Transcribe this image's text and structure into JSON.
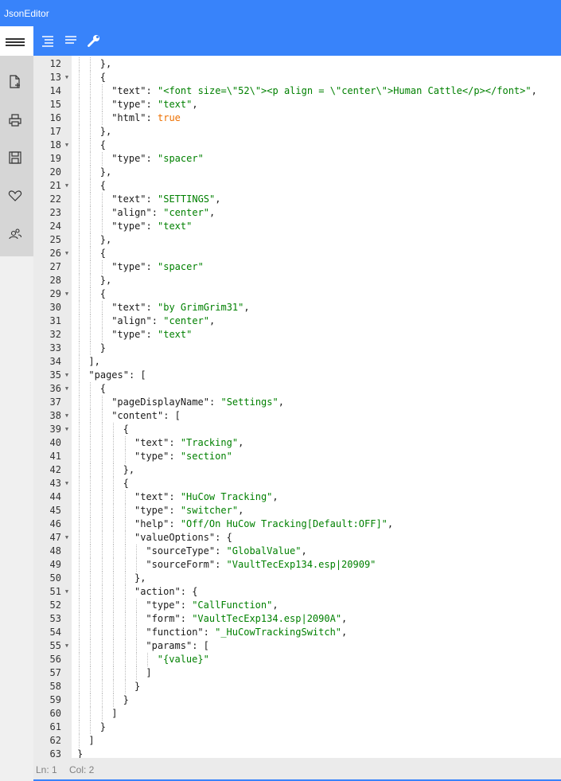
{
  "app": {
    "title": "JsonEditor"
  },
  "sidebar": {
    "icons": [
      "menu-icon",
      "new-file-icon",
      "print-icon",
      "save-icon",
      "heart-icon",
      "users-icon"
    ]
  },
  "toolbar": {
    "icons": [
      "format-json-icon",
      "compact-json-icon",
      "settings-wrench-icon"
    ],
    "accent": "#3883fa"
  },
  "editor": {
    "lines": [
      {
        "n": "12",
        "fold": false,
        "indent": 2,
        "tokens": [
          {
            "t": "},",
            "c": "p"
          }
        ]
      },
      {
        "n": "13",
        "fold": true,
        "indent": 2,
        "tokens": [
          {
            "t": "{",
            "c": "p"
          }
        ]
      },
      {
        "n": "14",
        "fold": false,
        "indent": 3,
        "tokens": [
          {
            "t": "\"text\"",
            "c": "k"
          },
          {
            "t": ": ",
            "c": "p"
          },
          {
            "t": "\"<font size=\\\"52\\\"><p align = \\\"center\\\">Human Cattle</p></font>\"",
            "c": "s"
          },
          {
            "t": ",",
            "c": "p"
          }
        ]
      },
      {
        "n": "15",
        "fold": false,
        "indent": 3,
        "tokens": [
          {
            "t": "\"type\"",
            "c": "k"
          },
          {
            "t": ": ",
            "c": "p"
          },
          {
            "t": "\"text\"",
            "c": "s"
          },
          {
            "t": ",",
            "c": "p"
          }
        ]
      },
      {
        "n": "16",
        "fold": false,
        "indent": 3,
        "tokens": [
          {
            "t": "\"html\"",
            "c": "k"
          },
          {
            "t": ": ",
            "c": "p"
          },
          {
            "t": "true",
            "c": "b"
          }
        ]
      },
      {
        "n": "17",
        "fold": false,
        "indent": 2,
        "tokens": [
          {
            "t": "},",
            "c": "p"
          }
        ]
      },
      {
        "n": "18",
        "fold": true,
        "indent": 2,
        "tokens": [
          {
            "t": "{",
            "c": "p"
          }
        ]
      },
      {
        "n": "19",
        "fold": false,
        "indent": 3,
        "tokens": [
          {
            "t": "\"type\"",
            "c": "k"
          },
          {
            "t": ": ",
            "c": "p"
          },
          {
            "t": "\"spacer\"",
            "c": "s"
          }
        ]
      },
      {
        "n": "20",
        "fold": false,
        "indent": 2,
        "tokens": [
          {
            "t": "},",
            "c": "p"
          }
        ]
      },
      {
        "n": "21",
        "fold": true,
        "indent": 2,
        "tokens": [
          {
            "t": "{",
            "c": "p"
          }
        ]
      },
      {
        "n": "22",
        "fold": false,
        "indent": 3,
        "tokens": [
          {
            "t": "\"text\"",
            "c": "k"
          },
          {
            "t": ": ",
            "c": "p"
          },
          {
            "t": "\"SETTINGS\"",
            "c": "s"
          },
          {
            "t": ",",
            "c": "p"
          }
        ]
      },
      {
        "n": "23",
        "fold": false,
        "indent": 3,
        "tokens": [
          {
            "t": "\"align\"",
            "c": "k"
          },
          {
            "t": ": ",
            "c": "p"
          },
          {
            "t": "\"center\"",
            "c": "s"
          },
          {
            "t": ",",
            "c": "p"
          }
        ]
      },
      {
        "n": "24",
        "fold": false,
        "indent": 3,
        "tokens": [
          {
            "t": "\"type\"",
            "c": "k"
          },
          {
            "t": ": ",
            "c": "p"
          },
          {
            "t": "\"text\"",
            "c": "s"
          }
        ]
      },
      {
        "n": "25",
        "fold": false,
        "indent": 2,
        "tokens": [
          {
            "t": "},",
            "c": "p"
          }
        ]
      },
      {
        "n": "26",
        "fold": true,
        "indent": 2,
        "tokens": [
          {
            "t": "{",
            "c": "p"
          }
        ]
      },
      {
        "n": "27",
        "fold": false,
        "indent": 3,
        "tokens": [
          {
            "t": "\"type\"",
            "c": "k"
          },
          {
            "t": ": ",
            "c": "p"
          },
          {
            "t": "\"spacer\"",
            "c": "s"
          }
        ]
      },
      {
        "n": "28",
        "fold": false,
        "indent": 2,
        "tokens": [
          {
            "t": "},",
            "c": "p"
          }
        ]
      },
      {
        "n": "29",
        "fold": true,
        "indent": 2,
        "tokens": [
          {
            "t": "{",
            "c": "p"
          }
        ]
      },
      {
        "n": "30",
        "fold": false,
        "indent": 3,
        "tokens": [
          {
            "t": "\"text\"",
            "c": "k"
          },
          {
            "t": ": ",
            "c": "p"
          },
          {
            "t": "\"by GrimGrim31\"",
            "c": "s"
          },
          {
            "t": ",",
            "c": "p"
          }
        ]
      },
      {
        "n": "31",
        "fold": false,
        "indent": 3,
        "tokens": [
          {
            "t": "\"align\"",
            "c": "k"
          },
          {
            "t": ": ",
            "c": "p"
          },
          {
            "t": "\"center\"",
            "c": "s"
          },
          {
            "t": ",",
            "c": "p"
          }
        ]
      },
      {
        "n": "32",
        "fold": false,
        "indent": 3,
        "tokens": [
          {
            "t": "\"type\"",
            "c": "k"
          },
          {
            "t": ": ",
            "c": "p"
          },
          {
            "t": "\"text\"",
            "c": "s"
          }
        ]
      },
      {
        "n": "33",
        "fold": false,
        "indent": 2,
        "tokens": [
          {
            "t": "}",
            "c": "p"
          }
        ]
      },
      {
        "n": "34",
        "fold": false,
        "indent": 1,
        "tokens": [
          {
            "t": "],",
            "c": "p"
          }
        ]
      },
      {
        "n": "35",
        "fold": true,
        "indent": 1,
        "tokens": [
          {
            "t": "\"pages\"",
            "c": "k"
          },
          {
            "t": ": [",
            "c": "p"
          }
        ]
      },
      {
        "n": "36",
        "fold": true,
        "indent": 2,
        "tokens": [
          {
            "t": "{",
            "c": "p"
          }
        ]
      },
      {
        "n": "37",
        "fold": false,
        "indent": 3,
        "tokens": [
          {
            "t": "\"pageDisplayName\"",
            "c": "k"
          },
          {
            "t": ": ",
            "c": "p"
          },
          {
            "t": "\"Settings\"",
            "c": "s"
          },
          {
            "t": ",",
            "c": "p"
          }
        ]
      },
      {
        "n": "38",
        "fold": true,
        "indent": 3,
        "tokens": [
          {
            "t": "\"content\"",
            "c": "k"
          },
          {
            "t": ": [",
            "c": "p"
          }
        ]
      },
      {
        "n": "39",
        "fold": true,
        "indent": 4,
        "tokens": [
          {
            "t": "{",
            "c": "p"
          }
        ]
      },
      {
        "n": "40",
        "fold": false,
        "indent": 5,
        "tokens": [
          {
            "t": "\"text\"",
            "c": "k"
          },
          {
            "t": ": ",
            "c": "p"
          },
          {
            "t": "\"Tracking\"",
            "c": "s"
          },
          {
            "t": ",",
            "c": "p"
          }
        ]
      },
      {
        "n": "41",
        "fold": false,
        "indent": 5,
        "tokens": [
          {
            "t": "\"type\"",
            "c": "k"
          },
          {
            "t": ": ",
            "c": "p"
          },
          {
            "t": "\"section\"",
            "c": "s"
          }
        ]
      },
      {
        "n": "42",
        "fold": false,
        "indent": 4,
        "tokens": [
          {
            "t": "},",
            "c": "p"
          }
        ]
      },
      {
        "n": "43",
        "fold": true,
        "indent": 4,
        "tokens": [
          {
            "t": "{",
            "c": "p"
          }
        ]
      },
      {
        "n": "44",
        "fold": false,
        "indent": 5,
        "tokens": [
          {
            "t": "\"text\"",
            "c": "k"
          },
          {
            "t": ": ",
            "c": "p"
          },
          {
            "t": "\"HuCow Tracking\"",
            "c": "s"
          },
          {
            "t": ",",
            "c": "p"
          }
        ]
      },
      {
        "n": "45",
        "fold": false,
        "indent": 5,
        "tokens": [
          {
            "t": "\"type\"",
            "c": "k"
          },
          {
            "t": ": ",
            "c": "p"
          },
          {
            "t": "\"switcher\"",
            "c": "s"
          },
          {
            "t": ",",
            "c": "p"
          }
        ]
      },
      {
        "n": "46",
        "fold": false,
        "indent": 5,
        "tokens": [
          {
            "t": "\"help\"",
            "c": "k"
          },
          {
            "t": ": ",
            "c": "p"
          },
          {
            "t": "\"Off/On HuCow Tracking[Default:OFF]\"",
            "c": "s"
          },
          {
            "t": ",",
            "c": "p"
          }
        ]
      },
      {
        "n": "47",
        "fold": true,
        "indent": 5,
        "tokens": [
          {
            "t": "\"valueOptions\"",
            "c": "k"
          },
          {
            "t": ": {",
            "c": "p"
          }
        ]
      },
      {
        "n": "48",
        "fold": false,
        "indent": 6,
        "tokens": [
          {
            "t": "\"sourceType\"",
            "c": "k"
          },
          {
            "t": ": ",
            "c": "p"
          },
          {
            "t": "\"GlobalValue\"",
            "c": "s"
          },
          {
            "t": ",",
            "c": "p"
          }
        ]
      },
      {
        "n": "49",
        "fold": false,
        "indent": 6,
        "tokens": [
          {
            "t": "\"sourceForm\"",
            "c": "k"
          },
          {
            "t": ": ",
            "c": "p"
          },
          {
            "t": "\"VaultTecExp134.esp|20909\"",
            "c": "s"
          }
        ]
      },
      {
        "n": "50",
        "fold": false,
        "indent": 5,
        "tokens": [
          {
            "t": "},",
            "c": "p"
          }
        ]
      },
      {
        "n": "51",
        "fold": true,
        "indent": 5,
        "tokens": [
          {
            "t": "\"action\"",
            "c": "k"
          },
          {
            "t": ": {",
            "c": "p"
          }
        ]
      },
      {
        "n": "52",
        "fold": false,
        "indent": 6,
        "tokens": [
          {
            "t": "\"type\"",
            "c": "k"
          },
          {
            "t": ": ",
            "c": "p"
          },
          {
            "t": "\"CallFunction\"",
            "c": "s"
          },
          {
            "t": ",",
            "c": "p"
          }
        ]
      },
      {
        "n": "53",
        "fold": false,
        "indent": 6,
        "tokens": [
          {
            "t": "\"form\"",
            "c": "k"
          },
          {
            "t": ": ",
            "c": "p"
          },
          {
            "t": "\"VaultTecExp134.esp|2090A\"",
            "c": "s"
          },
          {
            "t": ",",
            "c": "p"
          }
        ]
      },
      {
        "n": "54",
        "fold": false,
        "indent": 6,
        "tokens": [
          {
            "t": "\"function\"",
            "c": "k"
          },
          {
            "t": ": ",
            "c": "p"
          },
          {
            "t": "\"_HuCowTrackingSwitch\"",
            "c": "s"
          },
          {
            "t": ",",
            "c": "p"
          }
        ]
      },
      {
        "n": "55",
        "fold": true,
        "indent": 6,
        "tokens": [
          {
            "t": "\"params\"",
            "c": "k"
          },
          {
            "t": ": [",
            "c": "p"
          }
        ]
      },
      {
        "n": "56",
        "fold": false,
        "indent": 7,
        "tokens": [
          {
            "t": "\"{value}\"",
            "c": "s"
          }
        ]
      },
      {
        "n": "57",
        "fold": false,
        "indent": 6,
        "tokens": [
          {
            "t": "]",
            "c": "p"
          }
        ]
      },
      {
        "n": "58",
        "fold": false,
        "indent": 5,
        "tokens": [
          {
            "t": "}",
            "c": "p"
          }
        ]
      },
      {
        "n": "59",
        "fold": false,
        "indent": 4,
        "tokens": [
          {
            "t": "}",
            "c": "p"
          }
        ]
      },
      {
        "n": "60",
        "fold": false,
        "indent": 3,
        "tokens": [
          {
            "t": "]",
            "c": "p"
          }
        ]
      },
      {
        "n": "61",
        "fold": false,
        "indent": 2,
        "tokens": [
          {
            "t": "}",
            "c": "p"
          }
        ]
      },
      {
        "n": "62",
        "fold": false,
        "indent": 1,
        "tokens": [
          {
            "t": "]",
            "c": "p"
          }
        ]
      },
      {
        "n": "63",
        "fold": false,
        "indent": 0,
        "tokens": [
          {
            "t": "}",
            "c": "p"
          }
        ]
      }
    ]
  },
  "status": {
    "ln": "Ln: 1",
    "col": "Col: 2"
  }
}
